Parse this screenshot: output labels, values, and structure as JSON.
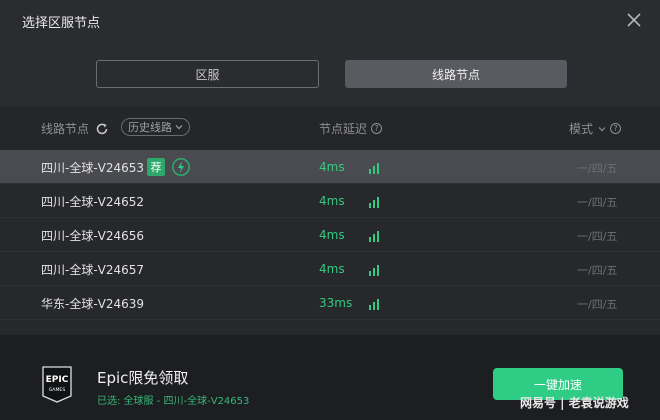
{
  "window": {
    "title": "选择区服节点"
  },
  "tabs": [
    {
      "label": "区服"
    },
    {
      "label": "线路节点"
    }
  ],
  "header": {
    "node_label": "线路节点",
    "history_label": "历史线路",
    "latency_label": "节点延迟",
    "mode_label": "模式"
  },
  "rows": [
    {
      "name": "四川-全球-V24653",
      "latency": "4ms",
      "mode": "一/四/五",
      "badge": "荐",
      "selected": true
    },
    {
      "name": "四川-全球-V24652",
      "latency": "4ms",
      "mode": "一/四/五"
    },
    {
      "name": "四川-全球-V24656",
      "latency": "4ms",
      "mode": "一/四/五"
    },
    {
      "name": "四川-全球-V24657",
      "latency": "4ms",
      "mode": "一/四/五"
    },
    {
      "name": "华东-全球-V24639",
      "latency": "33ms",
      "mode": "一/四/五"
    }
  ],
  "footer": {
    "game_name": "Epic限免领取",
    "selected_info": "已选: 全球服 - 四川-全球-V24653",
    "accelerate_label": "一键加速",
    "logo_text_top": "EPIC",
    "logo_text_bottom": "GAMES",
    "watermark": "网易号 | 老袁说游戏"
  },
  "colors": {
    "accent_green": "#2ecc85",
    "latency_green": "#34c97f",
    "background": "#2b2c30"
  }
}
